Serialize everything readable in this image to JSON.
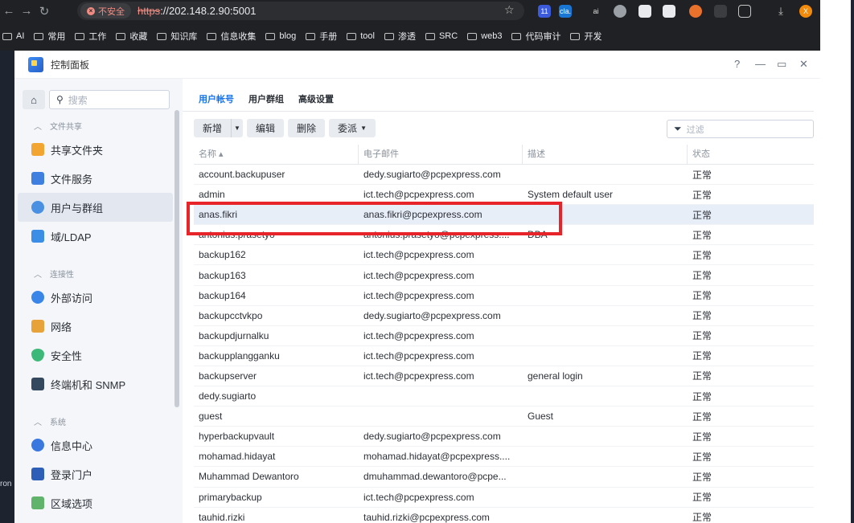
{
  "browser": {
    "insecure_label": "不安全",
    "url_scheme": "https",
    "url_rest": "://202.148.2.90:5001",
    "ext_badges": [
      "11",
      "cla.",
      "ai",
      "",
      "",
      "",
      "",
      "",
      "",
      "X"
    ],
    "bookmarks": [
      "AI",
      "常用",
      "工作",
      "收藏",
      "知识库",
      "信息收集",
      "blog",
      "手册",
      "tool",
      "渗透",
      "SRC",
      "web3",
      "代码审计",
      "开发"
    ]
  },
  "desktop": {
    "left_text": "ron"
  },
  "window": {
    "title": "控制面板",
    "controls": [
      "?",
      "—",
      "▭",
      "✕"
    ]
  },
  "sidebar": {
    "search_placeholder": "搜索",
    "sections": [
      {
        "label": "文件共享",
        "items": [
          "共享文件夹",
          "文件服务",
          "用户与群组",
          "域/LDAP"
        ]
      },
      {
        "label": "连接性",
        "items": [
          "外部访问",
          "网络",
          "安全性",
          "终端机和 SNMP"
        ]
      },
      {
        "label": "系统",
        "items": [
          "信息中心",
          "登录门户",
          "区域选项"
        ]
      }
    ],
    "active_item": "用户与群组"
  },
  "main": {
    "tabs": [
      "用户帐号",
      "用户群组",
      "高级设置"
    ],
    "active_tab": "用户帐号",
    "toolbar": {
      "create": "新增",
      "edit": "编辑",
      "delete": "删除",
      "delegate": "委派"
    },
    "filter_placeholder": "过滤",
    "columns": [
      "名称 ▴",
      "电子邮件",
      "描述",
      "状态"
    ],
    "rows": [
      [
        "account.backupuser",
        "dedy.sugiarto@pcpexpress.com",
        "",
        "正常"
      ],
      [
        "admin",
        "ict.tech@pcpexpress.com",
        "System default user",
        "正常"
      ],
      [
        "anas.fikri",
        "anas.fikri@pcpexpress.com",
        "",
        "正常"
      ],
      [
        "antonius.prasetyo",
        "antonius.prasetyo@pcpexpress....",
        "DBA",
        "正常"
      ],
      [
        "backup162",
        "ict.tech@pcpexpress.com",
        "",
        "正常"
      ],
      [
        "backup163",
        "ict.tech@pcpexpress.com",
        "",
        "正常"
      ],
      [
        "backup164",
        "ict.tech@pcpexpress.com",
        "",
        "正常"
      ],
      [
        "backupcctvkpo",
        "dedy.sugiarto@pcpexpress.com",
        "",
        "正常"
      ],
      [
        "backupdjurnalku",
        "ict.tech@pcpexpress.com",
        "",
        "正常"
      ],
      [
        "backupplangganku",
        "ict.tech@pcpexpress.com",
        "",
        "正常"
      ],
      [
        "backupserver",
        "ict.tech@pcpexpress.com",
        "general login",
        "正常"
      ],
      [
        "dedy.sugiarto",
        "",
        "",
        "正常"
      ],
      [
        "guest",
        "",
        "Guest",
        "正常"
      ],
      [
        "hyperbackupvault",
        "dedy.sugiarto@pcpexpress.com",
        "",
        "正常"
      ],
      [
        "mohamad.hidayat",
        "mohamad.hidayat@pcpexpress....",
        "",
        "正常"
      ],
      [
        "Muhammad Dewantoro",
        "dmuhammad.dewantoro@pcpe...",
        "",
        "正常"
      ],
      [
        "primarybackup",
        "ict.tech@pcpexpress.com",
        "",
        "正常"
      ],
      [
        "tauhid.rizki",
        "tauhid.rizki@pcpexpress.com",
        "",
        "正常"
      ]
    ],
    "selected_row": 2
  }
}
